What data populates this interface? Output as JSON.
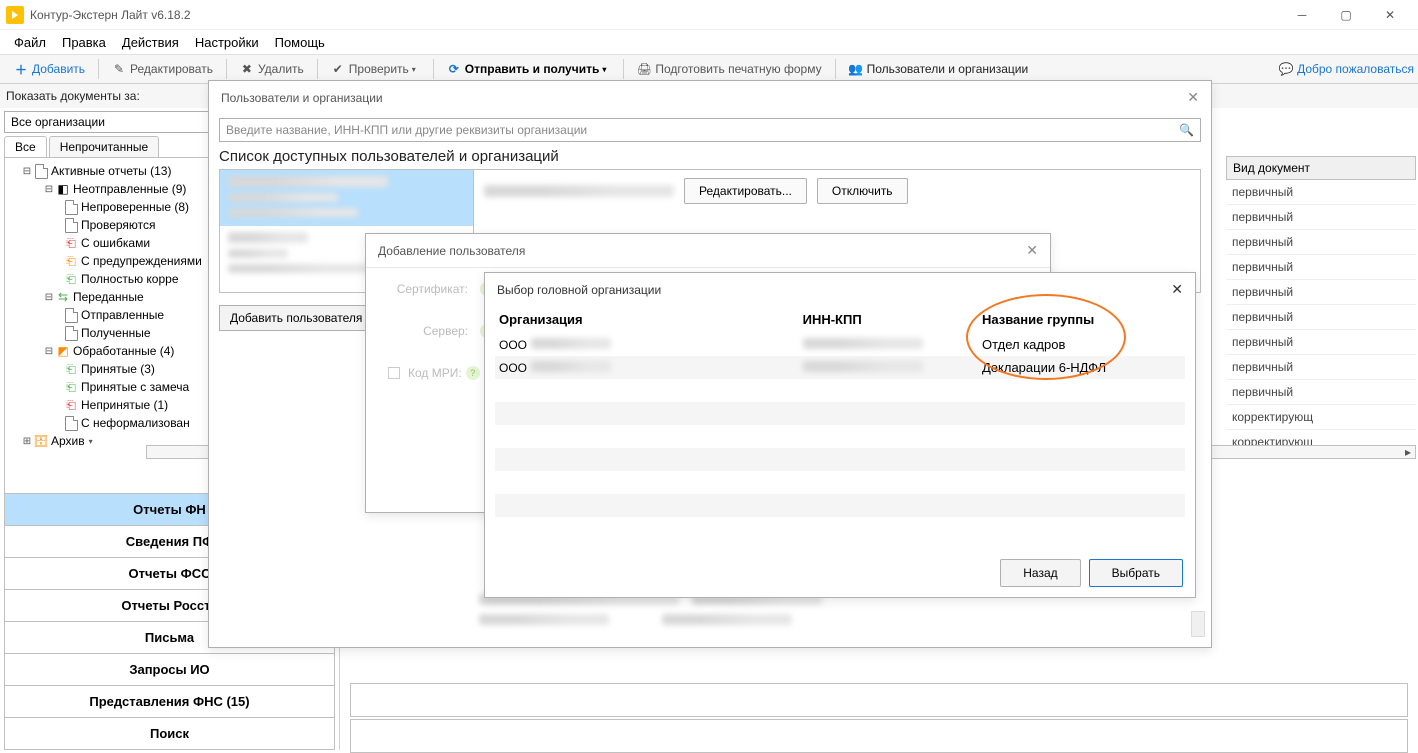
{
  "window": {
    "title": "Контур-Экстерн Лайт v6.18.2"
  },
  "menubar": [
    "Файл",
    "Правка",
    "Действия",
    "Настройки",
    "Помощь"
  ],
  "toolbar": {
    "add": "Добавить",
    "edit": "Редактировать",
    "delete": "Удалить",
    "check": "Проверить",
    "send": "Отправить и получить",
    "print": "Подготовить печатную форму",
    "users": "Пользователи и организации",
    "welcome": "Добро пожаловаться"
  },
  "filter_label": "Показать документы за:",
  "org_combo": "Все организации",
  "tabs": {
    "all": "Все",
    "unread": "Непрочитанные"
  },
  "tree": {
    "active": "Активные отчеты (13)",
    "unsent": "Неотправленные (9)",
    "unchecked": "Непроверенные (8)",
    "checking": "Проверяются",
    "errors": "С ошибками",
    "warnings": "С предупреждениями",
    "ok": "Полностью корре",
    "transferred": "Переданные",
    "sent": "Отправленные",
    "received": "Полученные",
    "processed": "Обработанные (4)",
    "accepted": "Принятые (3)",
    "accepted_w": "Принятые с замеча",
    "rejected": "Непринятые (1)",
    "nonformal": "С неформализован",
    "archive": "Архив"
  },
  "nav": {
    "fns": "Отчеты ФН",
    "pfr": "Сведения ПФ",
    "fss": "Отчеты ФСС",
    "rosstat": "Отчеты Росста",
    "letters": "Письма",
    "ion": "Запросы ИО",
    "repr": "Представления ФНС (15)",
    "search": "Поиск"
  },
  "rightcol": {
    "header": "Вид документ",
    "rows": [
      "первичный",
      "первичный",
      "первичный",
      "первичный",
      "первичный",
      "первичный",
      "первичный",
      "первичный",
      "первичный",
      "корректирующ",
      "корректирующ"
    ]
  },
  "dlg1": {
    "title": "Пользователи и организации",
    "search_ph": "Введите название, ИНН-КПП или другие реквизиты организации",
    "list_header": "Список доступных пользователей и организаций",
    "btn_edit": "Редактировать...",
    "btn_disable": "Отключить",
    "btn_add_user": "Добавить пользователя"
  },
  "dlg2": {
    "title": "Добавление пользователя",
    "cert": "Сертификат:",
    "server": "Сервер:",
    "mri": "Код МРИ:"
  },
  "dlg3": {
    "title": "Выбор головной организации",
    "col_org": "Организация",
    "col_inn": "ИНН-КПП",
    "col_grp": "Название группы",
    "row1_org": "ООО",
    "row1_grp": "Отдел кадров",
    "row2_org": "ООО",
    "row2_grp": "Декларации 6-НДФЛ",
    "btn_back": "Назад",
    "btn_select": "Выбрать"
  }
}
